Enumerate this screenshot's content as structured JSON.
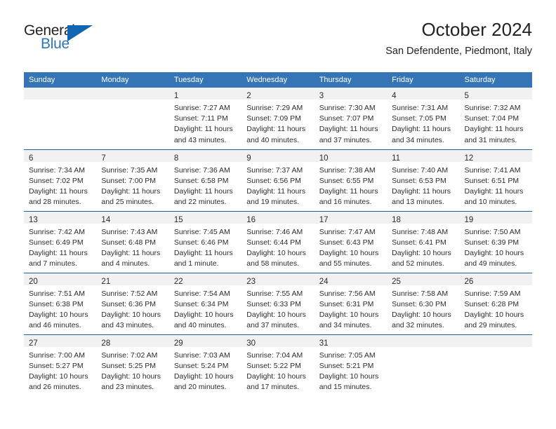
{
  "brand": {
    "name_top": "General",
    "name_bottom": "Blue",
    "triangle_icon": "brand-triangle-icon",
    "color_dark": "#231f20",
    "color_blue": "#2e75b6"
  },
  "header": {
    "title": "October 2024",
    "subtitle": "San Defendente, Piedmont, Italy"
  },
  "theme": {
    "header_blue": "#3575b5",
    "row_divider_blue": "#1f6096",
    "daynum_strip_gray": "#f1f1f1",
    "text": "#2b2b2b"
  },
  "weekday_headers": [
    "Sunday",
    "Monday",
    "Tuesday",
    "Wednesday",
    "Thursday",
    "Friday",
    "Saturday"
  ],
  "weeks": [
    [
      {
        "day": "",
        "lines": []
      },
      {
        "day": "",
        "lines": []
      },
      {
        "day": "1",
        "lines": [
          "Sunrise: 7:27 AM",
          "Sunset: 7:11 PM",
          "Daylight: 11 hours",
          "and 43 minutes."
        ]
      },
      {
        "day": "2",
        "lines": [
          "Sunrise: 7:29 AM",
          "Sunset: 7:09 PM",
          "Daylight: 11 hours",
          "and 40 minutes."
        ]
      },
      {
        "day": "3",
        "lines": [
          "Sunrise: 7:30 AM",
          "Sunset: 7:07 PM",
          "Daylight: 11 hours",
          "and 37 minutes."
        ]
      },
      {
        "day": "4",
        "lines": [
          "Sunrise: 7:31 AM",
          "Sunset: 7:05 PM",
          "Daylight: 11 hours",
          "and 34 minutes."
        ]
      },
      {
        "day": "5",
        "lines": [
          "Sunrise: 7:32 AM",
          "Sunset: 7:04 PM",
          "Daylight: 11 hours",
          "and 31 minutes."
        ]
      }
    ],
    [
      {
        "day": "6",
        "lines": [
          "Sunrise: 7:34 AM",
          "Sunset: 7:02 PM",
          "Daylight: 11 hours",
          "and 28 minutes."
        ]
      },
      {
        "day": "7",
        "lines": [
          "Sunrise: 7:35 AM",
          "Sunset: 7:00 PM",
          "Daylight: 11 hours",
          "and 25 minutes."
        ]
      },
      {
        "day": "8",
        "lines": [
          "Sunrise: 7:36 AM",
          "Sunset: 6:58 PM",
          "Daylight: 11 hours",
          "and 22 minutes."
        ]
      },
      {
        "day": "9",
        "lines": [
          "Sunrise: 7:37 AM",
          "Sunset: 6:56 PM",
          "Daylight: 11 hours",
          "and 19 minutes."
        ]
      },
      {
        "day": "10",
        "lines": [
          "Sunrise: 7:38 AM",
          "Sunset: 6:55 PM",
          "Daylight: 11 hours",
          "and 16 minutes."
        ]
      },
      {
        "day": "11",
        "lines": [
          "Sunrise: 7:40 AM",
          "Sunset: 6:53 PM",
          "Daylight: 11 hours",
          "and 13 minutes."
        ]
      },
      {
        "day": "12",
        "lines": [
          "Sunrise: 7:41 AM",
          "Sunset: 6:51 PM",
          "Daylight: 11 hours",
          "and 10 minutes."
        ]
      }
    ],
    [
      {
        "day": "13",
        "lines": [
          "Sunrise: 7:42 AM",
          "Sunset: 6:49 PM",
          "Daylight: 11 hours",
          "and 7 minutes."
        ]
      },
      {
        "day": "14",
        "lines": [
          "Sunrise: 7:43 AM",
          "Sunset: 6:48 PM",
          "Daylight: 11 hours",
          "and 4 minutes."
        ]
      },
      {
        "day": "15",
        "lines": [
          "Sunrise: 7:45 AM",
          "Sunset: 6:46 PM",
          "Daylight: 11 hours",
          "and 1 minute."
        ]
      },
      {
        "day": "16",
        "lines": [
          "Sunrise: 7:46 AM",
          "Sunset: 6:44 PM",
          "Daylight: 10 hours",
          "and 58 minutes."
        ]
      },
      {
        "day": "17",
        "lines": [
          "Sunrise: 7:47 AM",
          "Sunset: 6:43 PM",
          "Daylight: 10 hours",
          "and 55 minutes."
        ]
      },
      {
        "day": "18",
        "lines": [
          "Sunrise: 7:48 AM",
          "Sunset: 6:41 PM",
          "Daylight: 10 hours",
          "and 52 minutes."
        ]
      },
      {
        "day": "19",
        "lines": [
          "Sunrise: 7:50 AM",
          "Sunset: 6:39 PM",
          "Daylight: 10 hours",
          "and 49 minutes."
        ]
      }
    ],
    [
      {
        "day": "20",
        "lines": [
          "Sunrise: 7:51 AM",
          "Sunset: 6:38 PM",
          "Daylight: 10 hours",
          "and 46 minutes."
        ]
      },
      {
        "day": "21",
        "lines": [
          "Sunrise: 7:52 AM",
          "Sunset: 6:36 PM",
          "Daylight: 10 hours",
          "and 43 minutes."
        ]
      },
      {
        "day": "22",
        "lines": [
          "Sunrise: 7:54 AM",
          "Sunset: 6:34 PM",
          "Daylight: 10 hours",
          "and 40 minutes."
        ]
      },
      {
        "day": "23",
        "lines": [
          "Sunrise: 7:55 AM",
          "Sunset: 6:33 PM",
          "Daylight: 10 hours",
          "and 37 minutes."
        ]
      },
      {
        "day": "24",
        "lines": [
          "Sunrise: 7:56 AM",
          "Sunset: 6:31 PM",
          "Daylight: 10 hours",
          "and 34 minutes."
        ]
      },
      {
        "day": "25",
        "lines": [
          "Sunrise: 7:58 AM",
          "Sunset: 6:30 PM",
          "Daylight: 10 hours",
          "and 32 minutes."
        ]
      },
      {
        "day": "26",
        "lines": [
          "Sunrise: 7:59 AM",
          "Sunset: 6:28 PM",
          "Daylight: 10 hours",
          "and 29 minutes."
        ]
      }
    ],
    [
      {
        "day": "27",
        "lines": [
          "Sunrise: 7:00 AM",
          "Sunset: 5:27 PM",
          "Daylight: 10 hours",
          "and 26 minutes."
        ]
      },
      {
        "day": "28",
        "lines": [
          "Sunrise: 7:02 AM",
          "Sunset: 5:25 PM",
          "Daylight: 10 hours",
          "and 23 minutes."
        ]
      },
      {
        "day": "29",
        "lines": [
          "Sunrise: 7:03 AM",
          "Sunset: 5:24 PM",
          "Daylight: 10 hours",
          "and 20 minutes."
        ]
      },
      {
        "day": "30",
        "lines": [
          "Sunrise: 7:04 AM",
          "Sunset: 5:22 PM",
          "Daylight: 10 hours",
          "and 17 minutes."
        ]
      },
      {
        "day": "31",
        "lines": [
          "Sunrise: 7:05 AM",
          "Sunset: 5:21 PM",
          "Daylight: 10 hours",
          "and 15 minutes."
        ]
      },
      {
        "day": "",
        "lines": []
      },
      {
        "day": "",
        "lines": []
      }
    ]
  ]
}
